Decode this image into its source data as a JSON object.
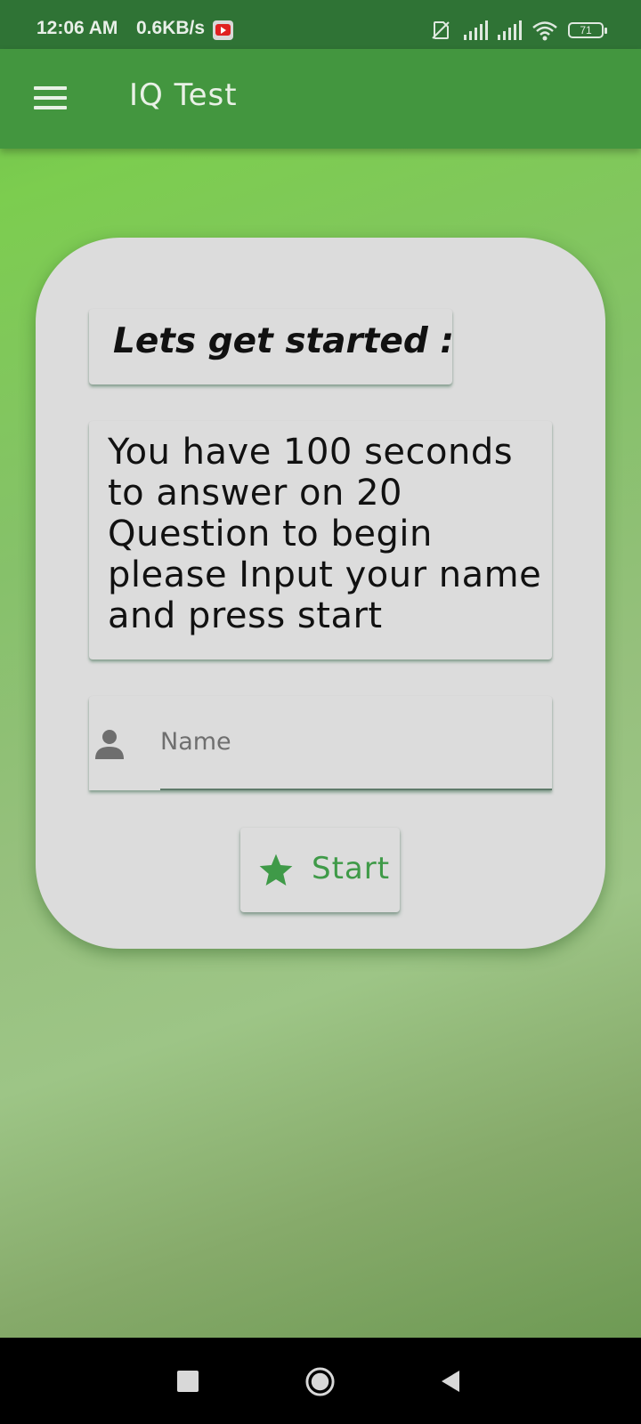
{
  "status_bar": {
    "time": "12:06 AM",
    "speed": "0.6KB/s",
    "battery": "71",
    "icons": [
      "youtube-notification-icon",
      "no-sim-icon",
      "signal-icon",
      "signal-icon",
      "wifi-icon",
      "battery-icon"
    ]
  },
  "app_bar": {
    "title": "IQ Test",
    "menu_icon": "hamburger-menu-icon"
  },
  "card": {
    "heading": "Lets get started :",
    "instructions": "You have 100 seconds to answer on 20 Question to begin please Input your name and press start",
    "name_field": {
      "placeholder": "Name",
      "value": "",
      "icon": "person-icon"
    },
    "start_button": {
      "label": "Start",
      "icon": "star-icon"
    }
  },
  "nav_bar": {
    "buttons": [
      "recents",
      "home",
      "back"
    ]
  },
  "colors": {
    "status_bar": "#2f7335",
    "app_bar": "#43963f",
    "card": "#dcdcdc",
    "accent": "#3f9a48"
  }
}
